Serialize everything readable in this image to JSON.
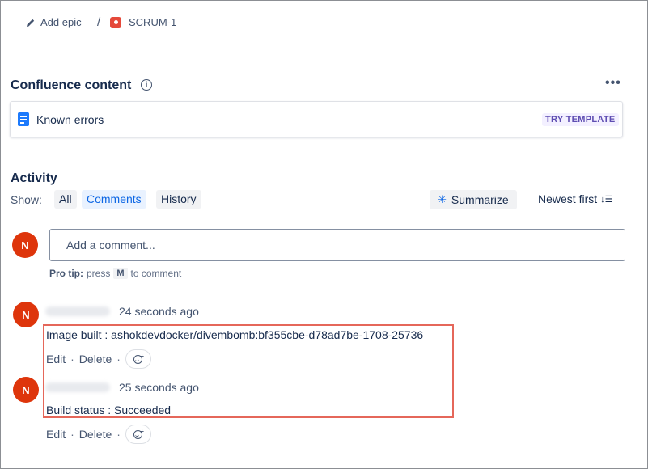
{
  "breadcrumb": {
    "epic_label": "Add epic",
    "separator": "/",
    "issue_key": "SCRUM-1"
  },
  "confluence": {
    "title": "Confluence content",
    "info_icon": "i",
    "more_icon": "•••",
    "item_label": "Known errors",
    "try_template_label": "TRY TEMPLATE"
  },
  "activity": {
    "title": "Activity",
    "show_label": "Show:",
    "tabs": [
      {
        "label": "All"
      },
      {
        "label": "Comments",
        "active": true
      },
      {
        "label": "History"
      }
    ],
    "summarize_label": "Summarize",
    "sort_label": "Newest first",
    "sort_icon": "↓☰"
  },
  "composer": {
    "avatar_initial": "N",
    "placeholder": "Add a comment...",
    "protip_prefix": "Pro tip:",
    "protip_press": "press",
    "protip_key": "M",
    "protip_suffix": "to comment"
  },
  "comments": [
    {
      "avatar_initial": "N",
      "time": "24 seconds ago",
      "body": "Image built : ashokdevdocker/divembomb:bf355cbe-d78ad7be-1708-25736",
      "edit_label": "Edit",
      "delete_label": "Delete",
      "dot": "·"
    },
    {
      "avatar_initial": "N",
      "time": "25 seconds ago",
      "body": "Build status : Succeeded",
      "edit_label": "Edit",
      "delete_label": "Delete",
      "dot": "·"
    }
  ],
  "colors": {
    "avatar": "#de350b",
    "highlight": "#e5675a",
    "accent": "#0c66e4",
    "template_badge": "#5e4db2"
  }
}
